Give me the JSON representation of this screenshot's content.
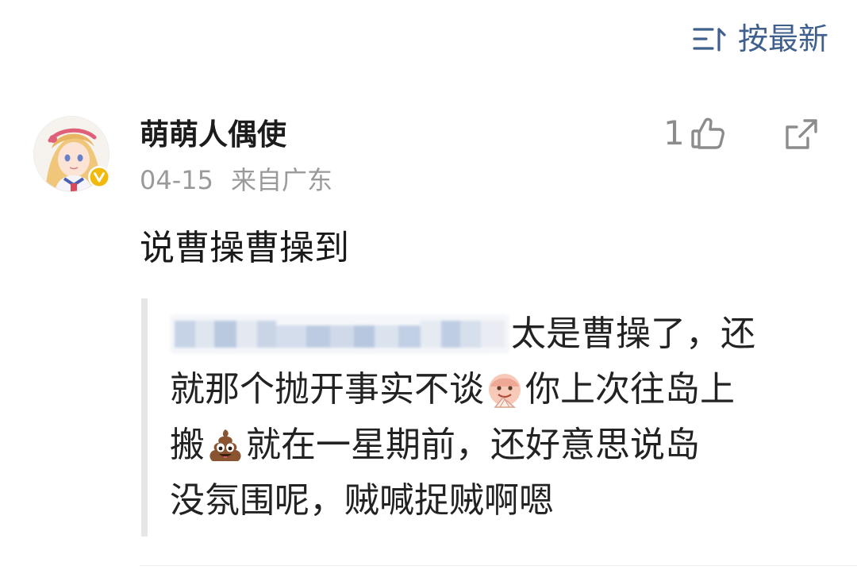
{
  "sort": {
    "label": "按最新",
    "icon": "sort-icon",
    "color": "#3f5f8c"
  },
  "comment": {
    "author": {
      "name": "萌萌人偶使",
      "verified": true,
      "badge_color": "#f2b90c"
    },
    "date": "04-15",
    "location": "来自广东",
    "likes": "1",
    "text": "说曹操曹操到",
    "quote": {
      "line1": "太是曹操了，还",
      "line2a": "就那个抛开事实不谈",
      "line2b": "你上次往岛上",
      "line3a": "搬",
      "line3b": "就在一星期前，还好意思说岛",
      "line4": "没氛围呢，贼喊捉贼啊嗯",
      "emojis": [
        "fan-face-emoji",
        "poop-emoji"
      ]
    }
  }
}
